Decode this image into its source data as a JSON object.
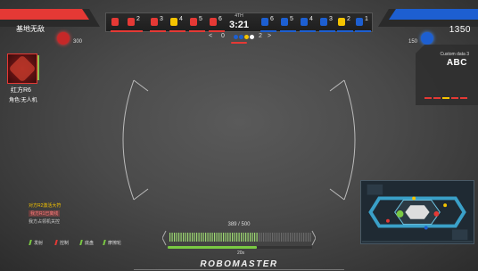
{
  "base_left": {
    "label": "基地无敌",
    "hp": "300",
    "icon": "red-base-icon",
    "color": "#e53935"
  },
  "base_right": {
    "value": "1350",
    "hp": "150",
    "icon": "blue-base-icon",
    "color": "#1d5fd1"
  },
  "scoreboard": {
    "red_slots": [
      "2",
      "3",
      "4",
      "5",
      "6"
    ],
    "blue_slots": [
      "6",
      "5",
      "4",
      "3",
      "2",
      "1"
    ],
    "round": "4TH",
    "clock": "3:21",
    "left_score": "0",
    "right_score": "2",
    "nav_left": "<",
    "nav_right": ">"
  },
  "robot": {
    "name": "红方R6",
    "role": "角色:无人机"
  },
  "custom_data": {
    "label": "Custom data 3",
    "value": "ABC"
  },
  "messages": [
    "对方R2激活大符",
    "我方R1已离线",
    "我方占领机关控"
  ],
  "tags": [
    "发射",
    "控制",
    "底盘",
    "摩擦轮"
  ],
  "ammo": "389 / 500",
  "energy": {
    "label": "20s",
    "fraction": 0.62
  },
  "logo": "ROBOMASTER",
  "colors": {
    "red": "#e53935",
    "blue": "#1d5fd1",
    "accent_green": "#7ac943",
    "yellow": "#f5c400"
  }
}
